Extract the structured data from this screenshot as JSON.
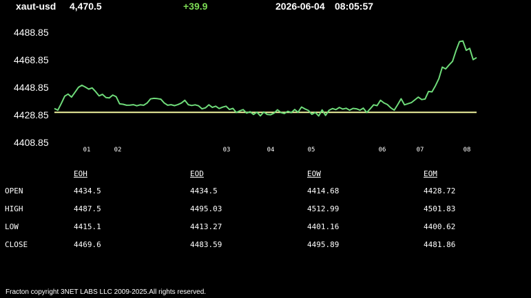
{
  "header": {
    "symbol": "xaut-usd",
    "price": "4,470.5",
    "change": "+39.9",
    "date": "2026-06-04",
    "time": "08:05:57"
  },
  "colors": {
    "background": "#000000",
    "price_line": "#6fdc7a",
    "reference_line": "#f2f5a0",
    "change_positive": "#7ddc55",
    "text": "#ffffff"
  },
  "chart_data": {
    "type": "line",
    "title": "",
    "xlabel": "",
    "ylabel": "",
    "ylim": [
      4408.85,
      4488.85
    ],
    "y_ticks": [
      "4488.85",
      "4468.85",
      "4448.85",
      "4428.85",
      "4408.85"
    ],
    "x_ticks": [
      "01",
      "02",
      "03",
      "04",
      "05",
      "06",
      "07",
      "08"
    ],
    "reference_value": 4430.7,
    "grid": false,
    "legend": "none",
    "series": [
      {
        "values": [
          4433.5,
          4432.3,
          4437.2,
          4442.5,
          4444.0,
          4441.8,
          4445.3,
          4448.9,
          4450.4,
          4449.1,
          4447.6,
          4448.5,
          4445.8,
          4442.7,
          4443.8,
          4441.5,
          4441.2,
          4443.3,
          4442.1,
          4436.9,
          4436.6,
          4435.9,
          4436.0,
          4436.3,
          4435.5,
          4436.2,
          4435.9,
          4437.5,
          4440.5,
          4440.9,
          4440.7,
          4440.3,
          4437.5,
          4435.9,
          4436.3,
          4435.6,
          4436.4,
          4437.5,
          4439.5,
          4436.3,
          4435.7,
          4436.2,
          4435.5,
          4433.3,
          4434.0,
          4436.2,
          4434.3,
          4435.2,
          4433.5,
          4434.5,
          4435.2,
          4432.8,
          4433.6,
          4430.6,
          4431.8,
          4432.7,
          4430.2,
          4431.2,
          4429.2,
          4430.9,
          4428.2,
          4431.0,
          4429.2,
          4429.0,
          4430.2,
          4432.6,
          4430.6,
          4429.9,
          4431.5,
          4430.5,
          4432.8,
          4430.8,
          4434.6,
          4433.2,
          4432.1,
          4429.3,
          4430.7,
          4428.1,
          4432.5,
          4428.5,
          4432.2,
          4433.5,
          4432.7,
          4434.3,
          4433.1,
          4433.7,
          4432.3,
          4433.6,
          4433.3,
          4432.3,
          4433.8,
          4430.6,
          4433.3,
          4436.2,
          4435.6,
          4439.5,
          4437.6,
          4436.4,
          4434.0,
          4432.3,
          4436.3,
          4440.6,
          4436.2,
          4437.0,
          4437.8,
          4439.8,
          4441.8,
          4440.0,
          4440.4,
          4445.9,
          4445.6,
          4450.0,
          4455.2,
          4463.6,
          4462.3,
          4465.2,
          4467.8,
          4475.5,
          4482.1,
          4482.6,
          4475.8,
          4477.2,
          4469.0,
          4470.5
        ]
      }
    ]
  },
  "table": {
    "columns": [
      "EOH",
      "EOD",
      "EOW",
      "EOM"
    ],
    "rows": [
      {
        "label": "OPEN",
        "values": [
          "4434.5",
          "4434.5",
          "4414.68",
          "4428.72"
        ]
      },
      {
        "label": "HIGH",
        "values": [
          "4487.5",
          "4495.03",
          "4512.99",
          "4501.83"
        ]
      },
      {
        "label": "LOW",
        "values": [
          "4415.1",
          "4413.27",
          "4401.16",
          "4400.62"
        ]
      },
      {
        "label": "CLOSE",
        "values": [
          "4469.6",
          "4483.59",
          "4495.89",
          "4481.86"
        ]
      }
    ]
  },
  "footer": "Fracton copyright 3NET LABS LLC 2009-2025.All rights reserved."
}
